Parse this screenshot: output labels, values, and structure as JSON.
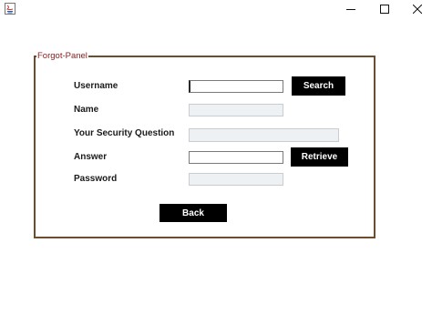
{
  "window": {
    "controls": {
      "minimize_icon": "minimize-icon",
      "maximize_icon": "maximize-icon",
      "close_icon": "close-icon"
    }
  },
  "panel": {
    "legend": "Forgot-Panel",
    "border_color": "#6b4e2e",
    "legend_color": "#8a2020"
  },
  "form": {
    "username_label": "Username",
    "username_value": "",
    "name_label": "Name",
    "name_value": "",
    "question_label": "Your Security Question",
    "question_value": "",
    "answer_label": "Answer",
    "answer_value": "",
    "password_label": "Password",
    "password_value": ""
  },
  "buttons": {
    "search": "Search",
    "retrieve": "Retrieve",
    "back": "Back",
    "color": "#000000"
  }
}
